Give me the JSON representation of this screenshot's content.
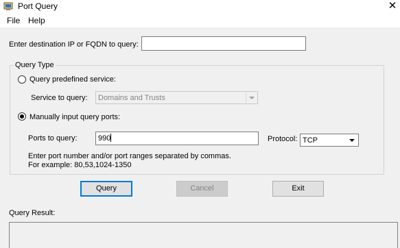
{
  "window": {
    "title": "Port Query",
    "close_glyph": "✕"
  },
  "menu": {
    "file": "File",
    "help": "Help"
  },
  "destination": {
    "label": "Enter destination IP or FQDN to query:",
    "value": ""
  },
  "query_type": {
    "title": "Query Type",
    "predefined_label": "Query predefined service:",
    "service_label": "Service to query:",
    "service_value": "Domains and Trusts",
    "manual_label": "Manually input query ports:",
    "ports_label": "Ports to query:",
    "ports_value": "990",
    "protocol_label": "Protocol:",
    "protocol_value": "TCP",
    "hint_line1": "Enter port number and/or port ranges separated by commas.",
    "hint_line2": "For example: 80,53,1024-1350",
    "selected": "manual"
  },
  "buttons": {
    "query": "Query",
    "cancel": "Cancel",
    "exit": "Exit"
  },
  "result": {
    "label": "Query Result:"
  },
  "colors": {
    "focus_border": "#0078d7",
    "window_bg": "#f0f0f0"
  }
}
